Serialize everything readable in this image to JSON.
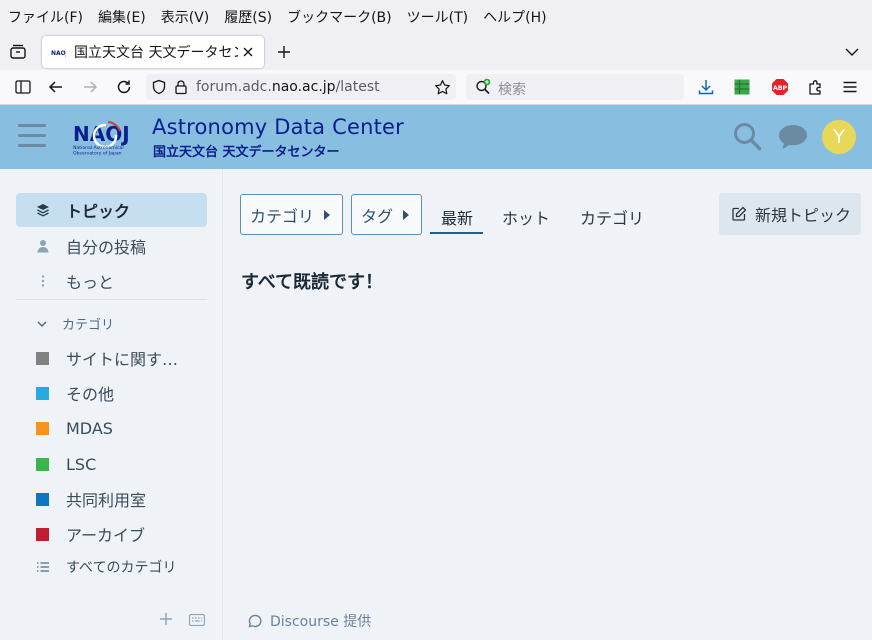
{
  "browser": {
    "menu": [
      "ファイル(F)",
      "編集(E)",
      "表示(V)",
      "履歴(S)",
      "ブックマーク(B)",
      "ツール(T)",
      "ヘルプ(H)"
    ],
    "tab_title": "国立天文台 天文データセンター",
    "url_host_prefix": "forum.adc.",
    "url_host_domain": "nao.ac.jp",
    "url_path": "/latest",
    "search_placeholder": "検索"
  },
  "header": {
    "brand_title": "Astronomy Data Center",
    "brand_subtitle": "国立天文台 天文データセンター",
    "logo_text": "NAOJ",
    "logo_line1": "National Astronomical",
    "logo_line2": "Observatory of Japan",
    "avatar_letter": "Y",
    "avatar_color": "#e8d85a",
    "header_color": "#88bfe1"
  },
  "sidebar": {
    "nav": [
      {
        "label": "トピック",
        "icon": "layers-icon",
        "active": true
      },
      {
        "label": "自分の投稿",
        "icon": "user-icon",
        "active": false
      },
      {
        "label": "もっと",
        "icon": "vertical-ellipsis-icon",
        "active": false
      }
    ],
    "section_label": "カテゴリ",
    "categories": [
      {
        "label": "サイトに関す…",
        "color": "#808281"
      },
      {
        "label": "その他",
        "color": "#25aae2"
      },
      {
        "label": "MDAS",
        "color": "#f7941d"
      },
      {
        "label": "LSC",
        "color": "#3ab54a"
      },
      {
        "label": "共同利用室",
        "color": "#0e76bd"
      },
      {
        "label": "アーカイブ",
        "color": "#be1e2d"
      }
    ],
    "all_categories": "すべてのカテゴリ"
  },
  "main": {
    "dropdowns": [
      "カテゴリ",
      "タグ"
    ],
    "tabs": [
      "最新",
      "ホット",
      "カテゴリ"
    ],
    "active_tab": "最新",
    "new_topic": "新規トピック",
    "empty_message": "すべて既読です！",
    "powered_by": "Discourse 提供"
  }
}
